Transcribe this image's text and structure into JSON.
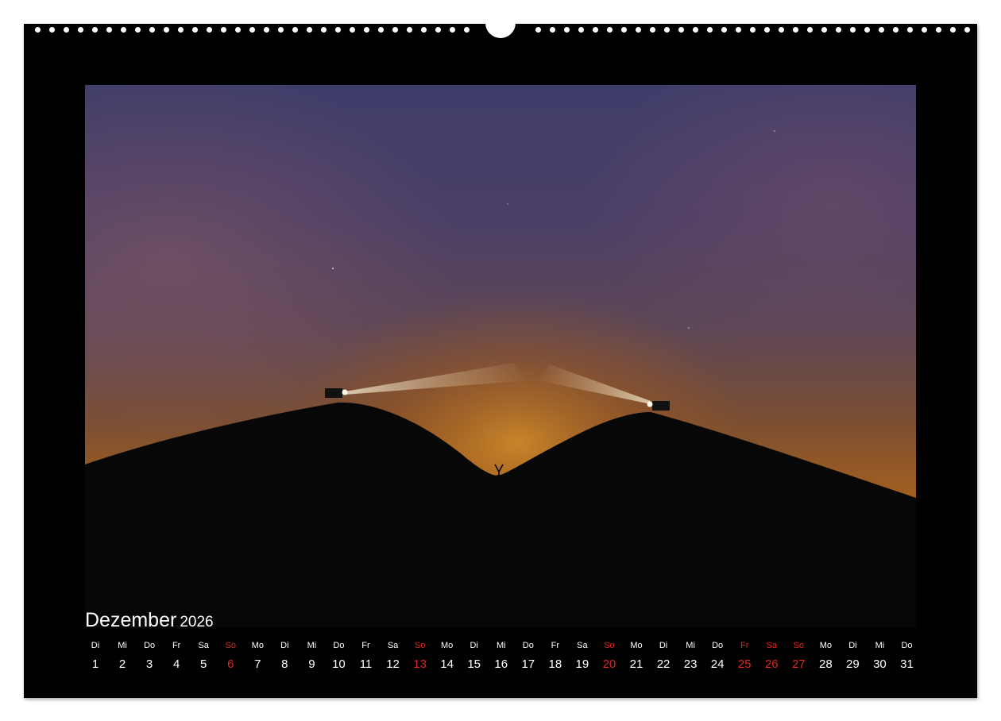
{
  "calendar": {
    "month": "Dezember",
    "year": "2026",
    "accent_color": "#e0271f",
    "days": [
      {
        "weekday": "Di",
        "day": "1",
        "red": false
      },
      {
        "weekday": "Mi",
        "day": "2",
        "red": false
      },
      {
        "weekday": "Do",
        "day": "3",
        "red": false
      },
      {
        "weekday": "Fr",
        "day": "4",
        "red": false
      },
      {
        "weekday": "Sa",
        "day": "5",
        "red": false
      },
      {
        "weekday": "So",
        "day": "6",
        "red": true
      },
      {
        "weekday": "Mo",
        "day": "7",
        "red": false
      },
      {
        "weekday": "Di",
        "day": "8",
        "red": false
      },
      {
        "weekday": "Mi",
        "day": "9",
        "red": false
      },
      {
        "weekday": "Do",
        "day": "10",
        "red": false
      },
      {
        "weekday": "Fr",
        "day": "11",
        "red": false
      },
      {
        "weekday": "Sa",
        "day": "12",
        "red": false
      },
      {
        "weekday": "So",
        "day": "13",
        "red": true
      },
      {
        "weekday": "Mo",
        "day": "14",
        "red": false
      },
      {
        "weekday": "Di",
        "day": "15",
        "red": false
      },
      {
        "weekday": "Mi",
        "day": "16",
        "red": false
      },
      {
        "weekday": "Do",
        "day": "17",
        "red": false
      },
      {
        "weekday": "Fr",
        "day": "18",
        "red": false
      },
      {
        "weekday": "Sa",
        "day": "19",
        "red": false
      },
      {
        "weekday": "So",
        "day": "20",
        "red": true
      },
      {
        "weekday": "Mo",
        "day": "21",
        "red": false
      },
      {
        "weekday": "Di",
        "day": "22",
        "red": false
      },
      {
        "weekday": "Mi",
        "day": "23",
        "red": false
      },
      {
        "weekday": "Do",
        "day": "24",
        "red": false
      },
      {
        "weekday": "Fr",
        "day": "25",
        "red": true
      },
      {
        "weekday": "Sa",
        "day": "26",
        "red": true
      },
      {
        "weekday": "So",
        "day": "27",
        "red": true
      },
      {
        "weekday": "Mo",
        "day": "28",
        "red": false
      },
      {
        "weekday": "Di",
        "day": "29",
        "red": false
      },
      {
        "weekday": "Mi",
        "day": "30",
        "red": false
      },
      {
        "weekday": "Do",
        "day": "31",
        "red": false
      }
    ]
  },
  "photo": {
    "subject": "night-sky-two-hills-searchlights",
    "icon": "landscape-photo"
  }
}
